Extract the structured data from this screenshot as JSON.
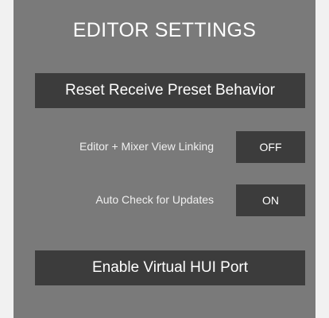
{
  "title": "EDITOR SETTINGS",
  "reset_button": {
    "label": "Reset Receive Preset Behavior"
  },
  "settings": [
    {
      "label": "Editor + Mixer View Linking",
      "value": "OFF"
    },
    {
      "label": "Auto Check for Updates",
      "value": "ON"
    }
  ],
  "hui_button": {
    "label": "Enable Virtual HUI Port"
  },
  "colors": {
    "page_background": "#f1f1f1",
    "panel_background": "#7a7a7a",
    "button_background": "#3c3c3c",
    "text": "#ffffff"
  }
}
